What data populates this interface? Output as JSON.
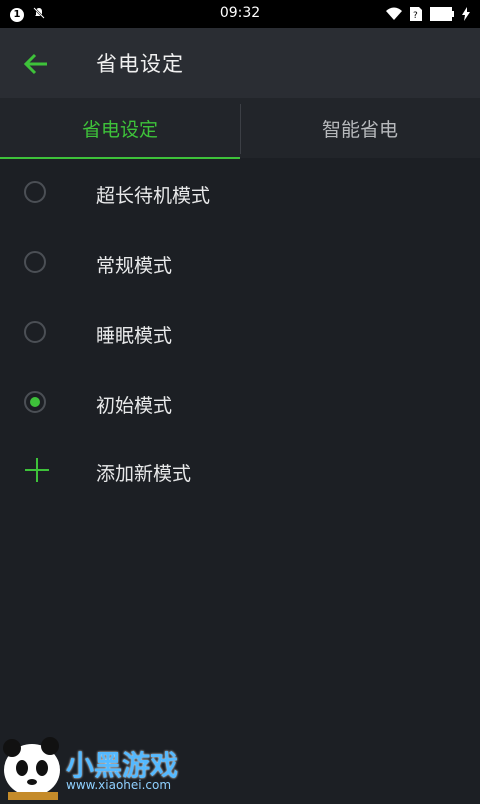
{
  "status_bar": {
    "time": "09:32",
    "notification_count": "1",
    "icons": [
      "mute-icon",
      "wifi-icon",
      "sim-icon",
      "battery-icon",
      "charging-icon"
    ]
  },
  "app_bar": {
    "title": "省电设定",
    "back_icon": "arrow-left-icon"
  },
  "tabs": [
    {
      "label": "省电设定",
      "active": true
    },
    {
      "label": "智能省电",
      "active": false
    }
  ],
  "modes": [
    {
      "label": "超长待机模式",
      "selected": false
    },
    {
      "label": "常规模式",
      "selected": false
    },
    {
      "label": "睡眠模式",
      "selected": false
    },
    {
      "label": "初始模式",
      "selected": true
    }
  ],
  "add_mode": {
    "label": "添加新模式"
  },
  "watermark": {
    "text": "小黑游戏",
    "url": "www.xiaohei.com"
  },
  "colors": {
    "accent": "#3ec23a",
    "background": "#1c1f24",
    "app_bar": "#2a2d33",
    "tab_bar": "#22252a"
  }
}
